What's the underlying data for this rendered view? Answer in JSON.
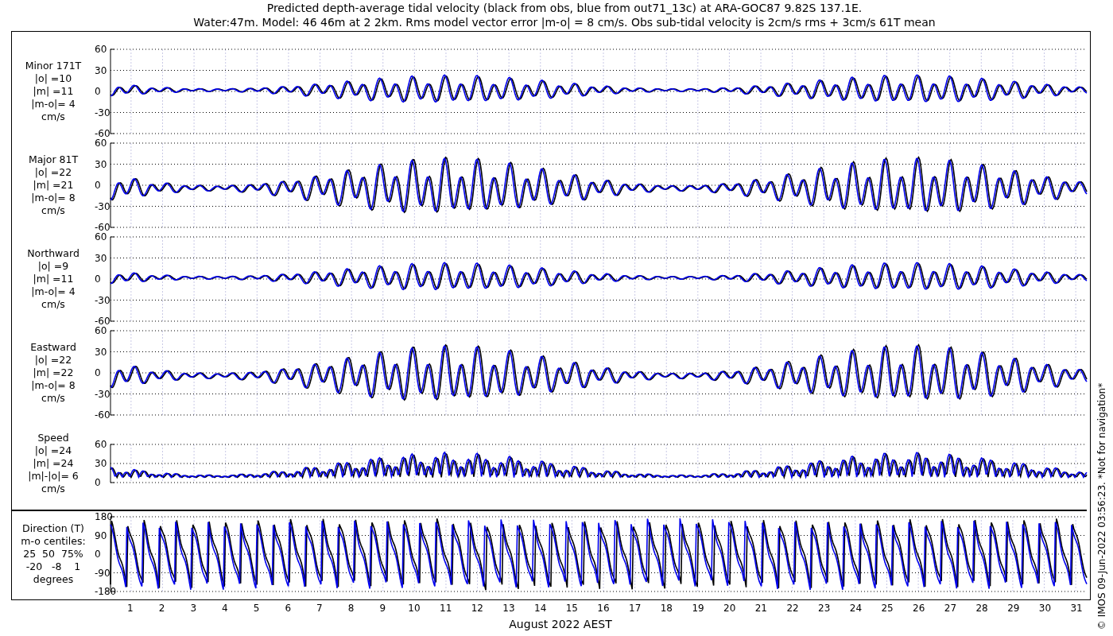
{
  "title": [
    "Predicted depth-average tidal velocity (black from obs, blue from out71_13c) at ARA-GOC87 9.82S 137.1E.",
    "Water:47m. Model: 46 46m at 2 2km. Rms model vector error |m-o| = 8 cm/s. Obs sub-tidal velocity is 2cm/s rms + 3cm/s 61T mean"
  ],
  "panels": [
    {
      "kind": "minor",
      "label": [
        "Minor 171T",
        "|o| =10",
        "|m| =11",
        "|m-o|= 4",
        "cm/s"
      ],
      "yticks": [
        "60",
        "30",
        "0",
        "-30",
        "-60"
      ]
    },
    {
      "kind": "major",
      "label": [
        "Major 81T",
        "|o| =22",
        "|m| =21",
        "|m-o|= 8",
        "cm/s"
      ],
      "yticks": [
        "60",
        "30",
        "0",
        "-30",
        "-60"
      ]
    },
    {
      "kind": "minor",
      "label": [
        "Northward",
        "|o| =9",
        "|m| =11",
        "|m-o|= 4",
        "cm/s"
      ],
      "yticks": [
        "60",
        "30",
        "0",
        "-30",
        "-60"
      ]
    },
    {
      "kind": "major",
      "label": [
        "Eastward",
        "|o| =22",
        "|m| =22",
        "|m-o|= 8",
        "cm/s"
      ],
      "yticks": [
        "60",
        "30",
        "0",
        "-30",
        "-60"
      ]
    },
    {
      "kind": "speed",
      "label": [
        "Speed",
        "|o| =24",
        "|m| =24",
        "|m|-|o|= 6",
        "cm/s"
      ],
      "yticks": [
        "60",
        "30",
        "0"
      ]
    }
  ],
  "direction_panel": {
    "kind": "direction",
    "label": [
      "Direction (T)",
      "m-o centiles:",
      "25  50  75%",
      "-20   -8    1",
      "degrees"
    ],
    "yticks": [
      "180",
      "90",
      "0",
      "-90",
      "-180"
    ]
  },
  "xticks": [
    "1",
    "2",
    "3",
    "4",
    "5",
    "6",
    "7",
    "8",
    "9",
    "10",
    "11",
    "12",
    "13",
    "14",
    "15",
    "16",
    "17",
    "18",
    "19",
    "20",
    "21",
    "22",
    "23",
    "24",
    "25",
    "26",
    "27",
    "28",
    "29",
    "30",
    "31"
  ],
  "xlabel": "August 2022 AEST",
  "side_note": "© IMOS 09-Jun-2022 03:56:23. *Not for navigation*"
}
